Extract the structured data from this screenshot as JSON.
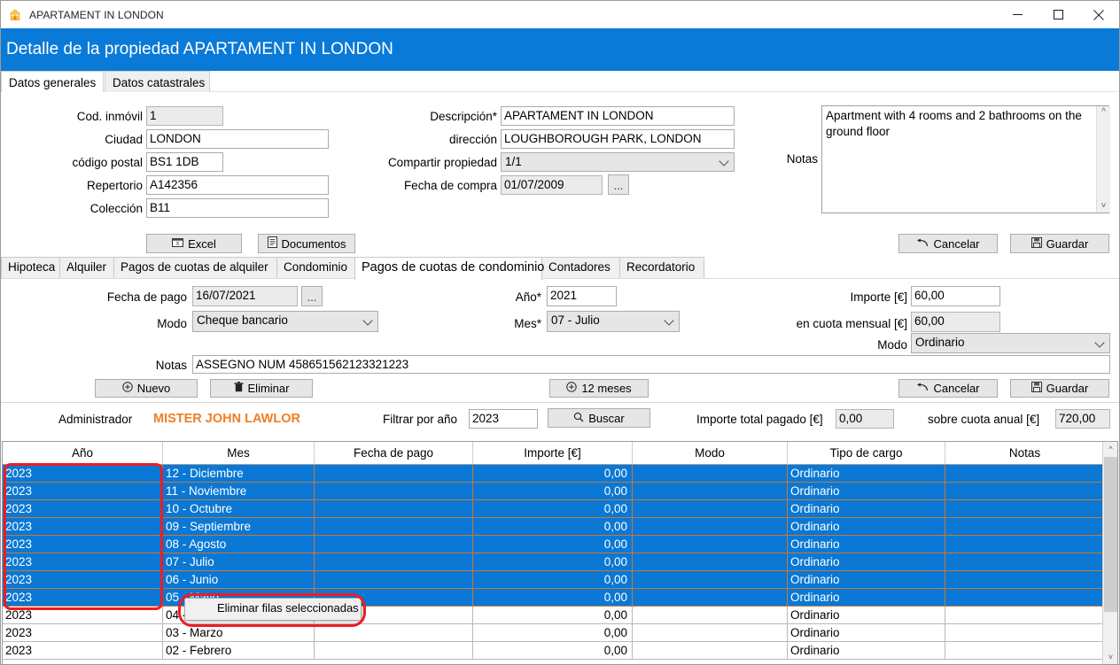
{
  "window": {
    "title": "APARTAMENT IN LONDON",
    "icon": "house-icon",
    "minimize": "minimize-icon",
    "maximize": "maximize-icon",
    "close": "close-icon"
  },
  "header": {
    "title": "Detalle de la propiedad APARTAMENT IN LONDON",
    "accent": "#0a7ad8"
  },
  "top_tabs": [
    {
      "label": "Datos generales",
      "selected": true
    },
    {
      "label": "Datos catastrales",
      "selected": false
    }
  ],
  "general": {
    "cod_inmovil": {
      "label": "Cod. inmóvil",
      "value": "1",
      "readonly": true
    },
    "ciudad": {
      "label": "Ciudad",
      "value": "LONDON",
      "readonly": false
    },
    "codigo_postal": {
      "label": "código postal",
      "value": "BS1 1DB",
      "readonly": false
    },
    "repertorio": {
      "label": "Repertorio",
      "value": "A142356",
      "readonly": false
    },
    "coleccion": {
      "label": "Colección",
      "value": "B11",
      "readonly": false
    },
    "descripcion": {
      "label": "Descripción*",
      "value": "APARTAMENT IN LONDON",
      "readonly": false
    },
    "direccion": {
      "label": "dirección",
      "value": "LOUGHBOROUGH PARK, LONDON",
      "readonly": false
    },
    "compartir": {
      "label": "Compartir propiedad",
      "value": "1/1"
    },
    "fecha_compra": {
      "label": "Fecha de compra",
      "value": "01/07/2009",
      "picker": "..."
    },
    "notas": {
      "label": "Notas",
      "value": "Apartment with 4 rooms and 2 bathrooms on the ground floor"
    }
  },
  "general_buttons": {
    "excel": "Excel",
    "documentos": "Documentos",
    "cancelar": "Cancelar",
    "guardar": "Guardar"
  },
  "section_tabs": [
    {
      "label": "Hipoteca",
      "selected": false
    },
    {
      "label": "Alquiler",
      "selected": false
    },
    {
      "label": "Pagos de cuotas de alquiler",
      "selected": false
    },
    {
      "label": "Condominio",
      "selected": false
    },
    {
      "label": "Pagos de cuotas de condominio",
      "selected": true
    },
    {
      "label": "Contadores",
      "selected": false
    },
    {
      "label": "Recordatorio",
      "selected": false
    }
  ],
  "payment": {
    "fecha_pago": {
      "label": "Fecha de pago",
      "value": "16/07/2021",
      "picker": "..."
    },
    "modo": {
      "label": "Modo",
      "value": "Cheque bancario"
    },
    "ano": {
      "label": "Año*",
      "value": "2021"
    },
    "mes": {
      "label": "Mes*",
      "value": "07 - Julio"
    },
    "importe": {
      "label": "Importe [€]",
      "value": "60,00"
    },
    "cuota_mensual": {
      "label": "en cuota mensual [€]",
      "value": "60,00",
      "readonly": true
    },
    "modo2": {
      "label": "Modo",
      "value": "Ordinario"
    },
    "notas": {
      "label": "Notas",
      "value": "ASSEGNO NUM 458651562123321223"
    }
  },
  "payment_buttons": {
    "nuevo": "Nuevo",
    "eliminar": "Eliminar",
    "doce_meses": "12 meses",
    "cancelar": "Cancelar",
    "guardar": "Guardar"
  },
  "filter_row": {
    "administrador_label": "Administrador",
    "administrador_value": "MISTER JOHN LAWLOR",
    "administrador_color": "#ef7e22",
    "filtrar_label": "Filtrar por año",
    "filtrar_value": "2023",
    "buscar": "Buscar",
    "total_label": "Importe total pagado [€]",
    "total_value": "0,00",
    "cuota_anual_label": "sobre cuota anual [€]",
    "cuota_anual_value": "720,00"
  },
  "grid": {
    "columns": [
      "Año",
      "Mes",
      "Fecha de pago",
      "Importe [€]",
      "Modo",
      "Tipo de cargo",
      "Notas"
    ],
    "selection_color": "#0a78d4",
    "rows": [
      {
        "ano": "2023",
        "mes": "12 - Diciembre",
        "fecha": "",
        "importe": "0,00",
        "modo": "",
        "tipo": "Ordinario",
        "notas": "",
        "selected": true
      },
      {
        "ano": "2023",
        "mes": "11 - Noviembre",
        "fecha": "",
        "importe": "0,00",
        "modo": "",
        "tipo": "Ordinario",
        "notas": "",
        "selected": true
      },
      {
        "ano": "2023",
        "mes": "10 - Octubre",
        "fecha": "",
        "importe": "0,00",
        "modo": "",
        "tipo": "Ordinario",
        "notas": "",
        "selected": true
      },
      {
        "ano": "2023",
        "mes": "09 - Septiembre",
        "fecha": "",
        "importe": "0,00",
        "modo": "",
        "tipo": "Ordinario",
        "notas": "",
        "selected": true
      },
      {
        "ano": "2023",
        "mes": "08 - Agosto",
        "fecha": "",
        "importe": "0,00",
        "modo": "",
        "tipo": "Ordinario",
        "notas": "",
        "selected": true
      },
      {
        "ano": "2023",
        "mes": "07 - Julio",
        "fecha": "",
        "importe": "0,00",
        "modo": "",
        "tipo": "Ordinario",
        "notas": "",
        "selected": true
      },
      {
        "ano": "2023",
        "mes": "06 - Junio",
        "fecha": "",
        "importe": "0,00",
        "modo": "",
        "tipo": "Ordinario",
        "notas": "",
        "selected": true
      },
      {
        "ano": "2023",
        "mes": "05 - Mayo",
        "fecha": "",
        "importe": "0,00",
        "modo": "",
        "tipo": "Ordinario",
        "notas": "",
        "selected": true
      },
      {
        "ano": "2023",
        "mes": "04 - Abril",
        "fecha": "",
        "importe": "0,00",
        "modo": "",
        "tipo": "Ordinario",
        "notas": "",
        "selected": false
      },
      {
        "ano": "2023",
        "mes": "03 - Marzo",
        "fecha": "",
        "importe": "0,00",
        "modo": "",
        "tipo": "Ordinario",
        "notas": "",
        "selected": false
      },
      {
        "ano": "2023",
        "mes": "02 - Febrero",
        "fecha": "",
        "importe": "0,00",
        "modo": "",
        "tipo": "Ordinario",
        "notas": "",
        "selected": false
      }
    ]
  },
  "context_menu": {
    "items": [
      "Eliminar filas seleccionadas"
    ]
  },
  "annotations": {
    "color": "#ee1c23"
  }
}
